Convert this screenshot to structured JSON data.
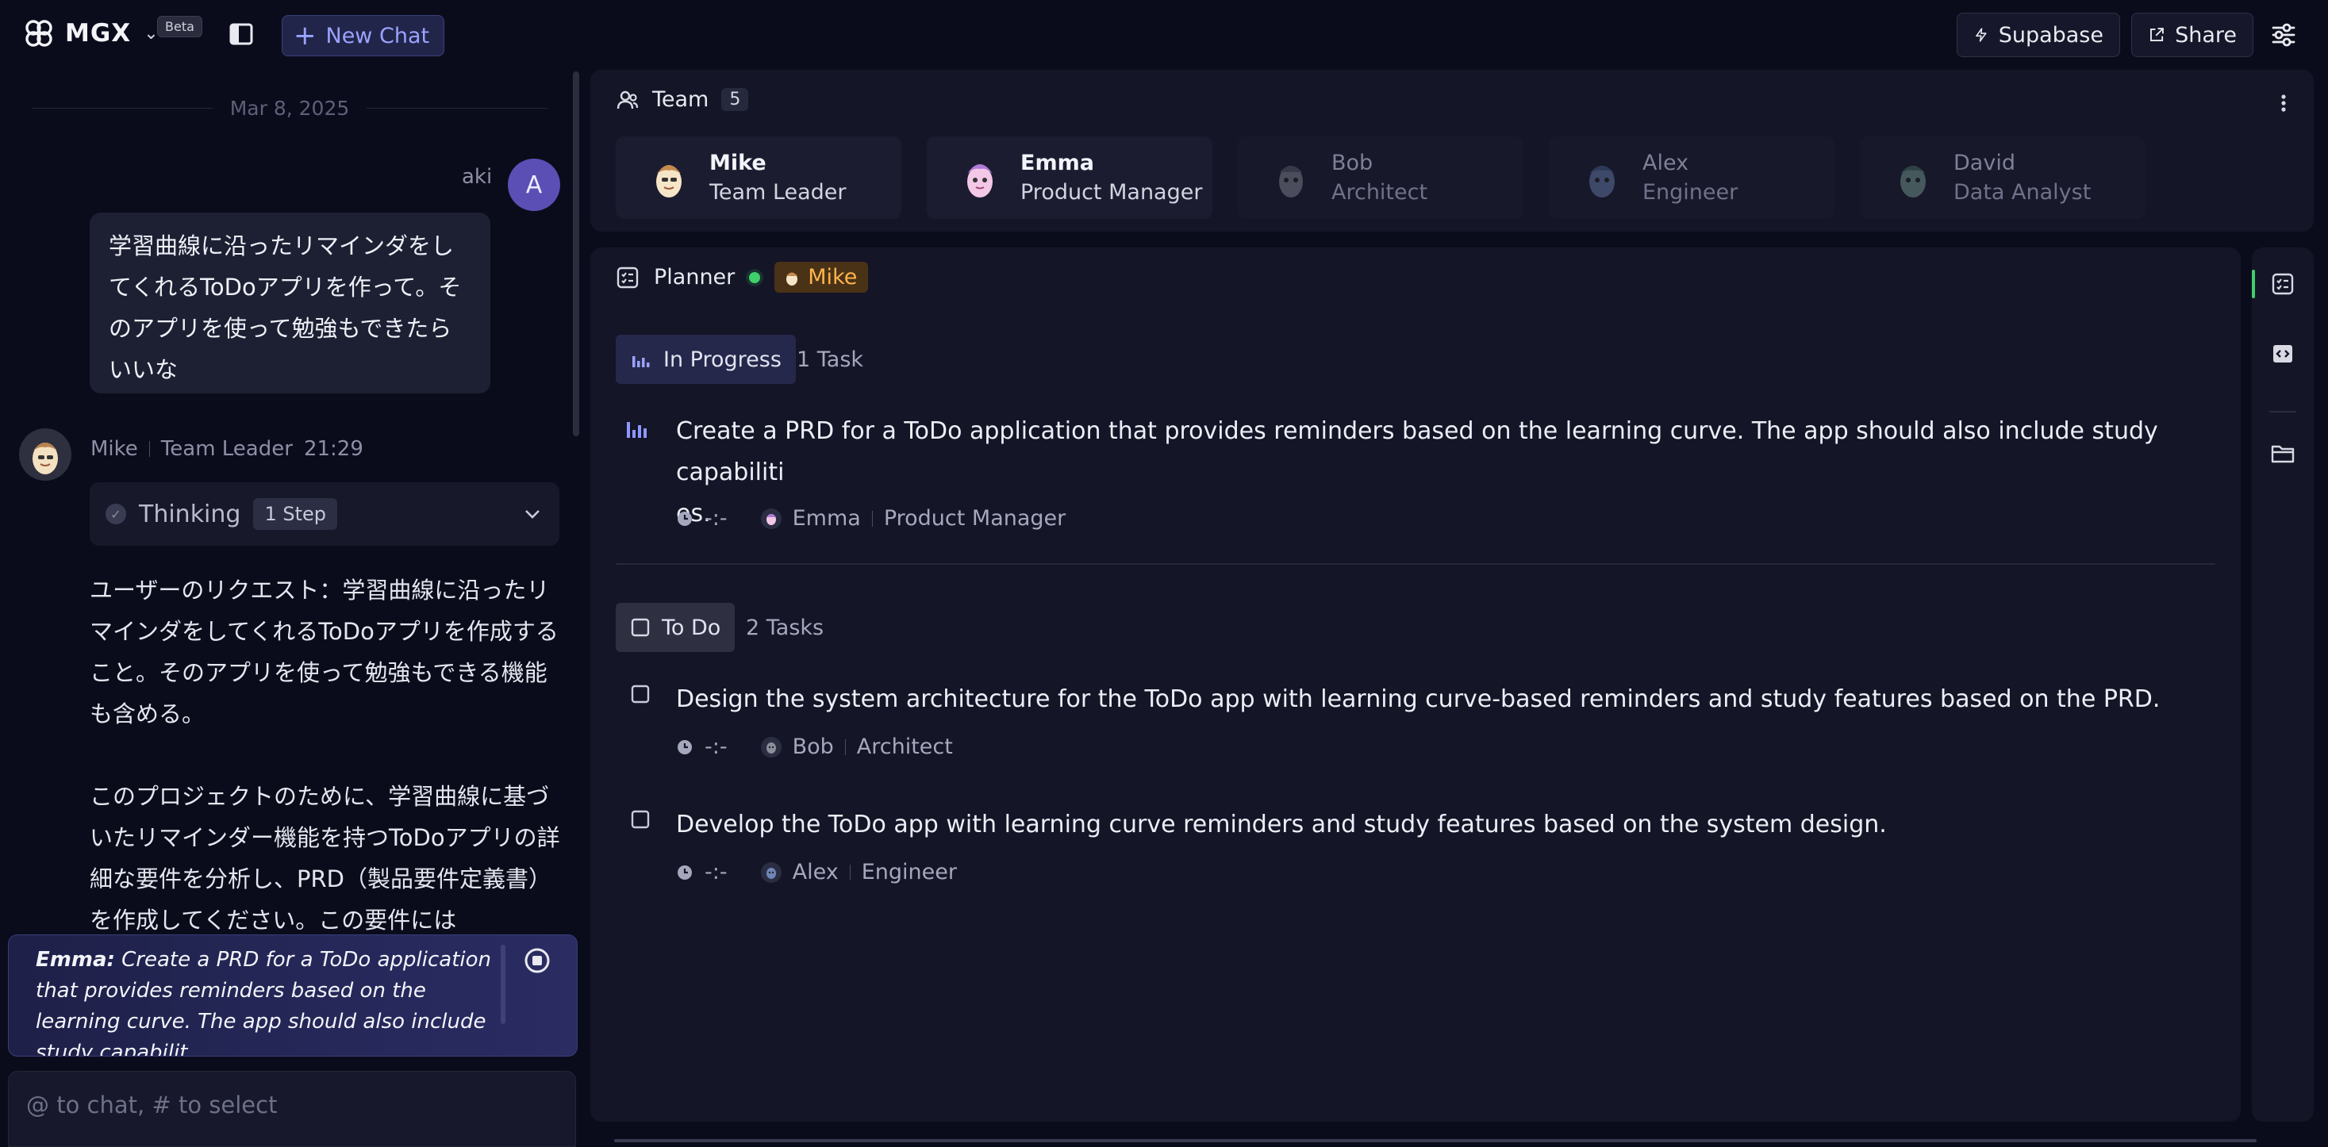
{
  "app": {
    "name": "MGX",
    "beta_label": "Beta",
    "new_chat_label": "New Chat"
  },
  "toolbar": {
    "supabase_label": "Supabase",
    "share_label": "Share"
  },
  "chat": {
    "date": "Mar 8, 2025",
    "user": {
      "name": "aki",
      "avatar_letter": "A",
      "message": "学習曲線に沿ったリマインダをしてくれるToDoアプリを作って。そのアプリを使って勉強もできたらいいな"
    },
    "reply": {
      "name": "Mike",
      "role": "Team Leader",
      "time": "21:29",
      "thinking_label": "Thinking",
      "thinking_steps": "1 Step",
      "paragraph_1": "ユーザーのリクエスト：学習曲線に沿ったリマインダをしてくれるToDoアプリを作成すること。そのアプリを使って勉強もできる機能も含める。",
      "paragraph_2": "このプロジェクトのために、学習曲線に基づいたリマインダー機能を持つToDoアプリの詳細な要件を分析し、PRD（製品要件定義書）を作成してください。この要件には"
    },
    "status": {
      "agent": "Emma:",
      "text": "Create a PRD for a ToDo application that provides reminders based on the learning curve. The app should also include study capabilit"
    },
    "input_placeholder": "@ to chat, # to select"
  },
  "team": {
    "label": "Team",
    "count": "5",
    "members": [
      {
        "name": "Mike",
        "role": "Team Leader",
        "active": true
      },
      {
        "name": "Emma",
        "role": "Product Manager",
        "active": true
      },
      {
        "name": "Bob",
        "role": "Architect",
        "active": false
      },
      {
        "name": "Alex",
        "role": "Engineer",
        "active": false
      },
      {
        "name": "David",
        "role": "Data Analyst",
        "active": false
      }
    ]
  },
  "planner": {
    "label": "Planner",
    "owner": "Mike",
    "in_progress": {
      "label": "In Progress",
      "count": "1 Task",
      "tasks": [
        {
          "title": "Create a PRD for a ToDo application that provides reminders based on the learning curve. The app should also include study capabiliti",
          "title_cont": "es.",
          "time": "-:-",
          "assignee": "Emma",
          "role": "Product Manager"
        }
      ]
    },
    "todo": {
      "label": "To Do",
      "count": "2 Tasks",
      "tasks": [
        {
          "title": "Design the system architecture for the ToDo app with learning curve-based reminders and study features based on the PRD.",
          "time": "-:-",
          "assignee": "Bob",
          "role": "Architect"
        },
        {
          "title": "Develop the ToDo app with learning curve reminders and study features based on the system design.",
          "time": "-:-",
          "assignee": "Alex",
          "role": "Engineer"
        }
      ]
    }
  },
  "icons": [
    "logo-icon",
    "chevron-down-icon",
    "sidebar-toggle-icon",
    "plus-icon",
    "supabase-icon",
    "share-icon",
    "settings-icon",
    "team-icon",
    "more-icon",
    "planner-icon",
    "bar-chart-icon",
    "checkbox-icon",
    "clock-icon",
    "stop-icon",
    "code-icon",
    "folder-icon"
  ],
  "colors": {
    "accent": "#9aa3ff",
    "active_dot": "#3ed06b",
    "owner_tag": "#ffb44a",
    "background": "#0b0c1b"
  }
}
